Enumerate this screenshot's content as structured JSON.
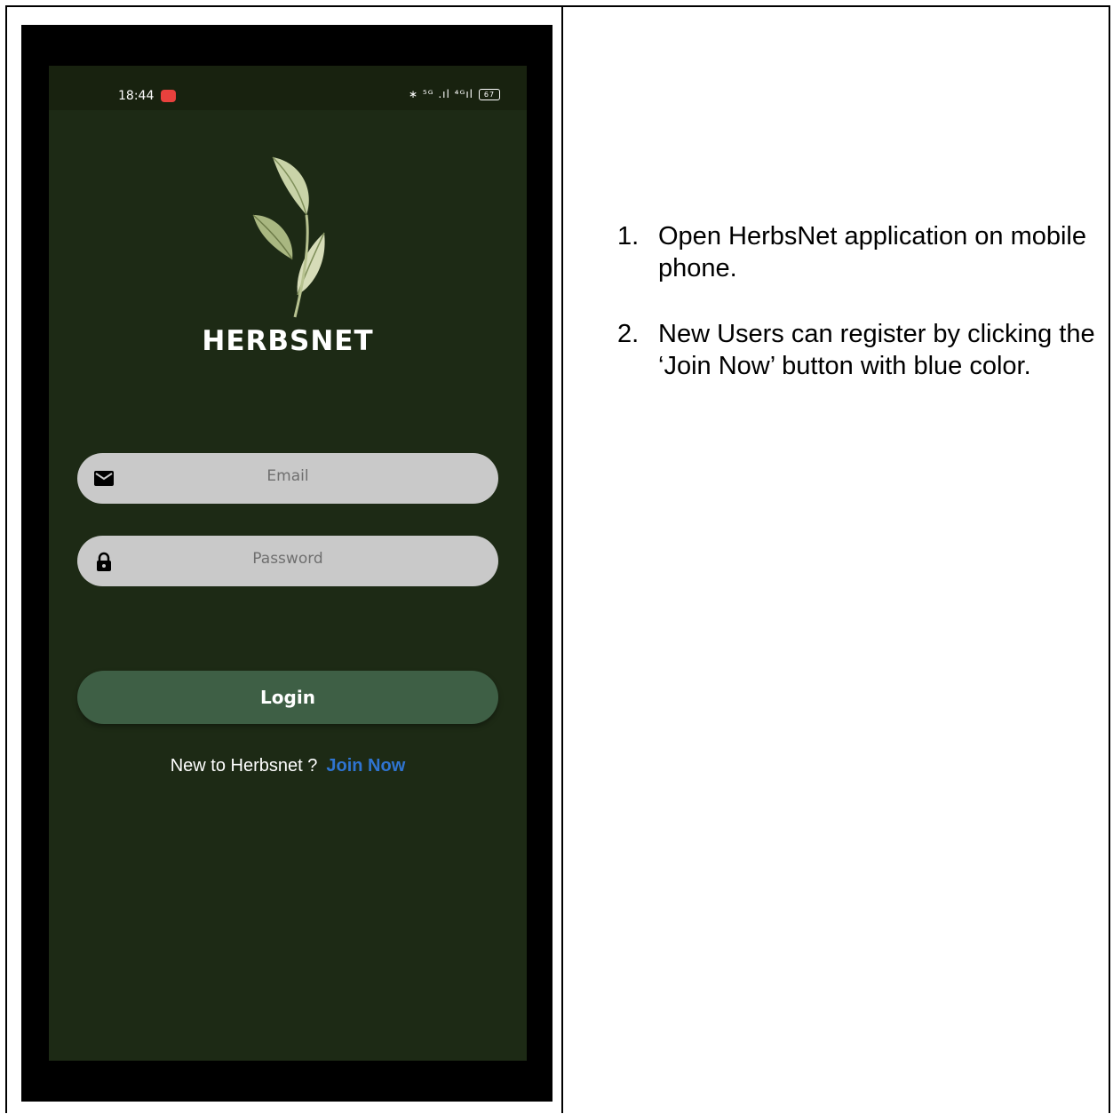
{
  "status_bar": {
    "time": "18:44",
    "icons_text": "∗ ⁵ᴳ .ıl ⁴ᴳıl",
    "battery": "67"
  },
  "app": {
    "brand": "HERBSNET",
    "email_placeholder": "Email",
    "password_placeholder": "Password",
    "login_label": "Login",
    "new_user_text": "New to Herbsnet ?",
    "join_label": "Join Now",
    "colors": {
      "background": "#1d2a15",
      "button": "#3e5f45",
      "field": "#c9c9c9",
      "link": "#2f74d0"
    },
    "icons": [
      "leaf-logo-icon",
      "mail-icon",
      "lock-icon"
    ]
  },
  "instructions": [
    {
      "num": "1.",
      "text": "Open HerbsNet application on mobile phone."
    },
    {
      "num": "2.",
      "text": "New Users can register by clicking the ‘Join Now’ button with blue color."
    }
  ]
}
